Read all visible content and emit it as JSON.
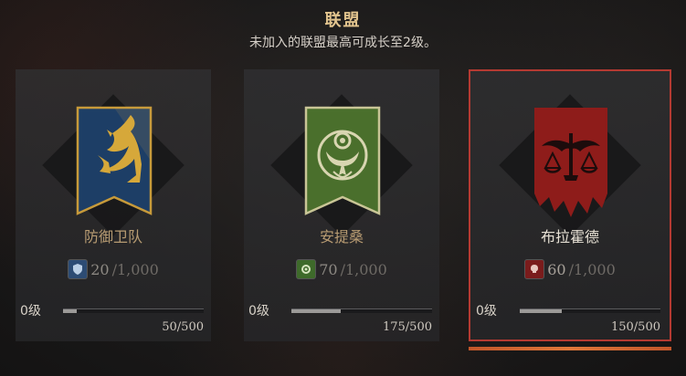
{
  "header": {
    "title": "联盟",
    "subtitle": "未加入的联盟最高可成长至2级。"
  },
  "alliances": [
    {
      "name": "防御卫队",
      "points": "20",
      "points_max": "/1,000",
      "level": "0级",
      "progress_text": "50/500",
      "progress": 0.1,
      "banner_color": "#1d3e66",
      "icon": "griffin-icon",
      "selected": false
    },
    {
      "name": "安提桑",
      "points": "70",
      "points_max": "/1,000",
      "level": "0级",
      "progress_text": "175/500",
      "progress": 0.35,
      "banner_color": "#4a6f2c",
      "icon": "gear-bird-icon",
      "selected": false
    },
    {
      "name": "布拉霍德",
      "points": "60",
      "points_max": "/1,000",
      "level": "0级",
      "progress_text": "150/500",
      "progress": 0.3,
      "banner_color": "#8e1c1a",
      "icon": "bat-scales-icon",
      "selected": true
    }
  ],
  "colors": {
    "accent_gold": "#e2c48e",
    "selected_border": "#b53a32",
    "selected_underline": "#e0783a"
  }
}
